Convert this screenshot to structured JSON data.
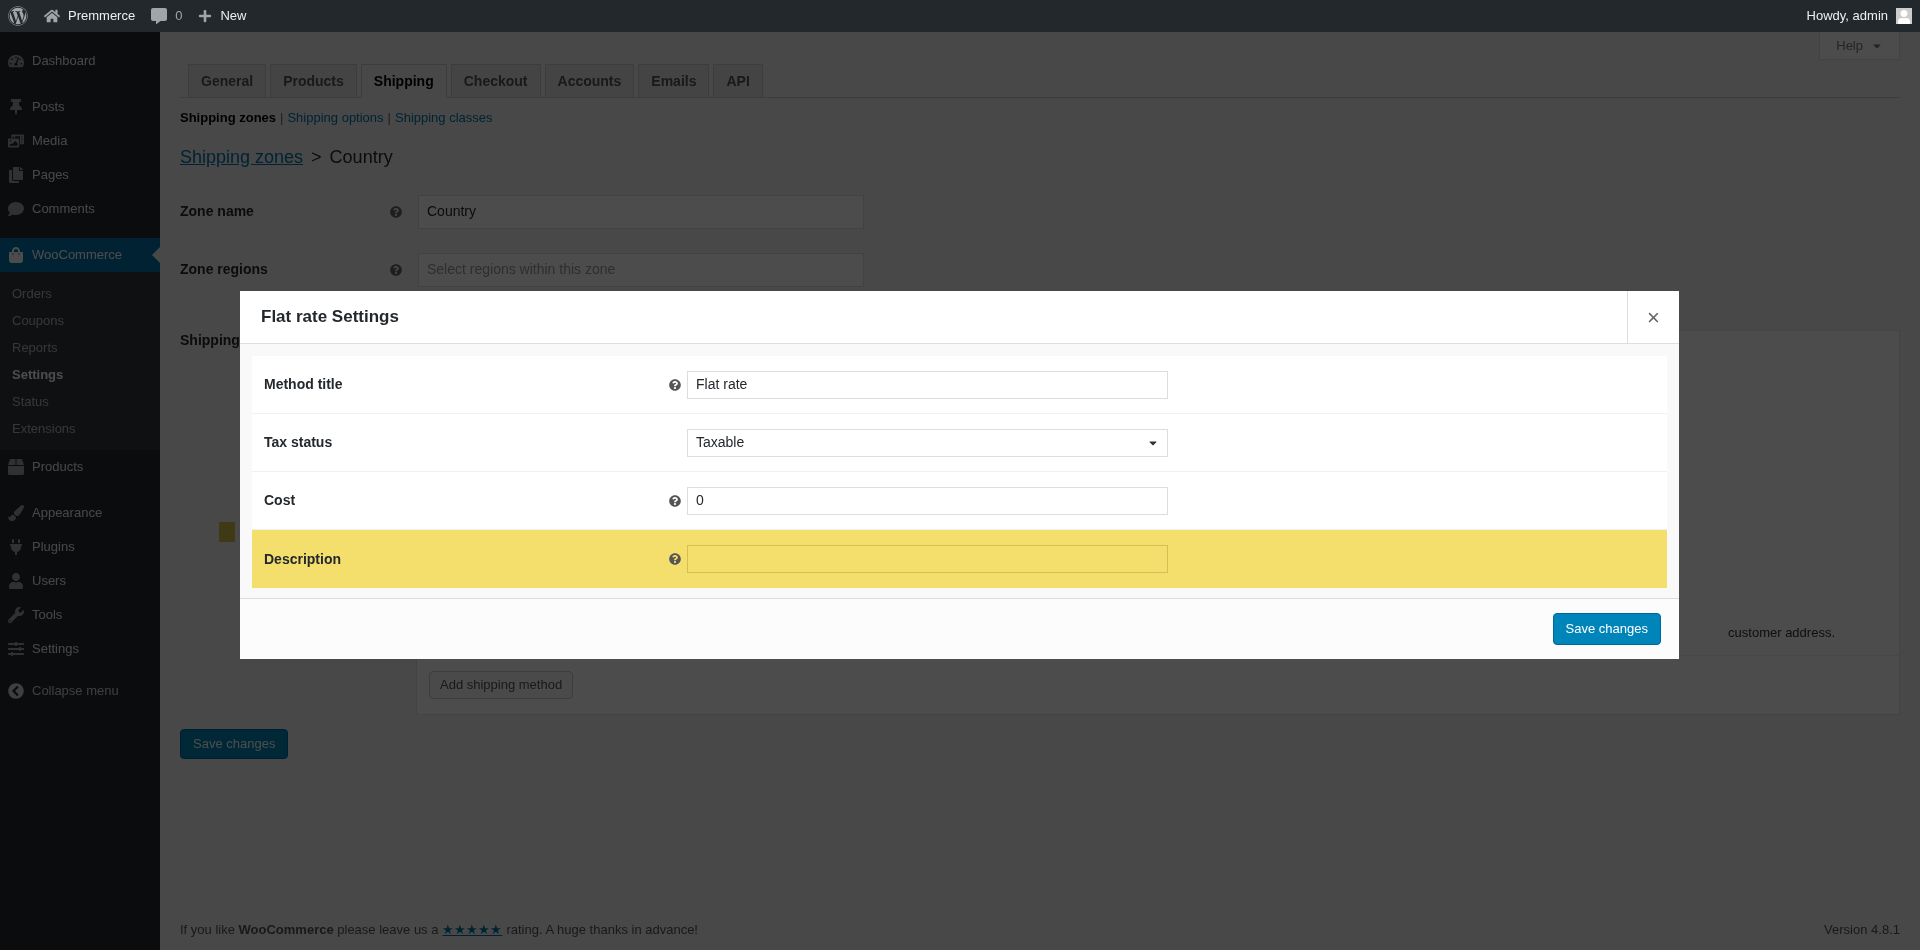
{
  "admin_bar": {
    "site_name": "Premmerce",
    "comments_count": "0",
    "new_label": "New",
    "greeting": "Howdy, admin"
  },
  "sidebar": {
    "groups": [
      [
        {
          "label": "Dashboard",
          "selected": false
        }
      ],
      [
        {
          "label": "Posts",
          "selected": false
        },
        {
          "label": "Media",
          "selected": false
        },
        {
          "label": "Pages",
          "selected": false
        },
        {
          "label": "Comments",
          "selected": false
        }
      ],
      [
        {
          "label": "WooCommerce",
          "selected": true,
          "children": [
            {
              "label": "Orders",
              "selected": false
            },
            {
              "label": "Coupons",
              "selected": false
            },
            {
              "label": "Reports",
              "selected": false
            },
            {
              "label": "Settings",
              "selected": true
            },
            {
              "label": "Status",
              "selected": false
            },
            {
              "label": "Extensions",
              "selected": false
            }
          ]
        },
        {
          "label": "Products",
          "selected": false
        }
      ],
      [
        {
          "label": "Appearance",
          "selected": false
        },
        {
          "label": "Plugins",
          "selected": false
        },
        {
          "label": "Users",
          "selected": false
        },
        {
          "label": "Tools",
          "selected": false
        },
        {
          "label": "Settings",
          "selected": false
        }
      ]
    ],
    "collapse_label": "Collapse menu"
  },
  "help_button": "Help",
  "tabs": [
    {
      "label": "General",
      "selected": false
    },
    {
      "label": "Products",
      "selected": false
    },
    {
      "label": "Shipping",
      "selected": true
    },
    {
      "label": "Checkout",
      "selected": false
    },
    {
      "label": "Accounts",
      "selected": false
    },
    {
      "label": "Emails",
      "selected": false
    },
    {
      "label": "API",
      "selected": false
    }
  ],
  "subnav": [
    {
      "label": "Shipping zones",
      "selected": true
    },
    {
      "divider": "|",
      "label": "Shipping options",
      "selected": false
    },
    {
      "divider": "|",
      "label": "Shipping classes",
      "selected": false
    }
  ],
  "breadcrumb": {
    "link": "Shipping zones",
    "separator": ">",
    "current": "Country"
  },
  "form": [
    {
      "label": "Zone name",
      "value": "Country"
    },
    {
      "label": "Zone regions",
      "placeholder": "Select regions within this zone"
    }
  ],
  "shipping_methods": {
    "label": "Shipping",
    "note": "customer address.",
    "add_button": "Add shipping method"
  },
  "save_button": "Save changes",
  "footer": {
    "text": "If you like **WooCommerce** please leave us a",
    "rating_link": "★★★★★",
    "text_after": "rating. A huge thanks in advance!",
    "version": "Version 4.8.1"
  },
  "modal": {
    "title": "Flat rate Settings",
    "close": "×",
    "fields": [
      {
        "kind": "text",
        "label": "Method title",
        "help": true,
        "value": "Flat rate",
        "highlighted": false
      },
      {
        "kind": "select",
        "label": "Tax status",
        "help": false,
        "value": "Taxable",
        "highlighted": false
      },
      {
        "kind": "text",
        "label": "Cost",
        "help": true,
        "value": "0",
        "highlighted": false
      },
      {
        "kind": "text",
        "label": "Description",
        "help": true,
        "highlighted": true
      }
    ],
    "save_button": "Save changes"
  }
}
